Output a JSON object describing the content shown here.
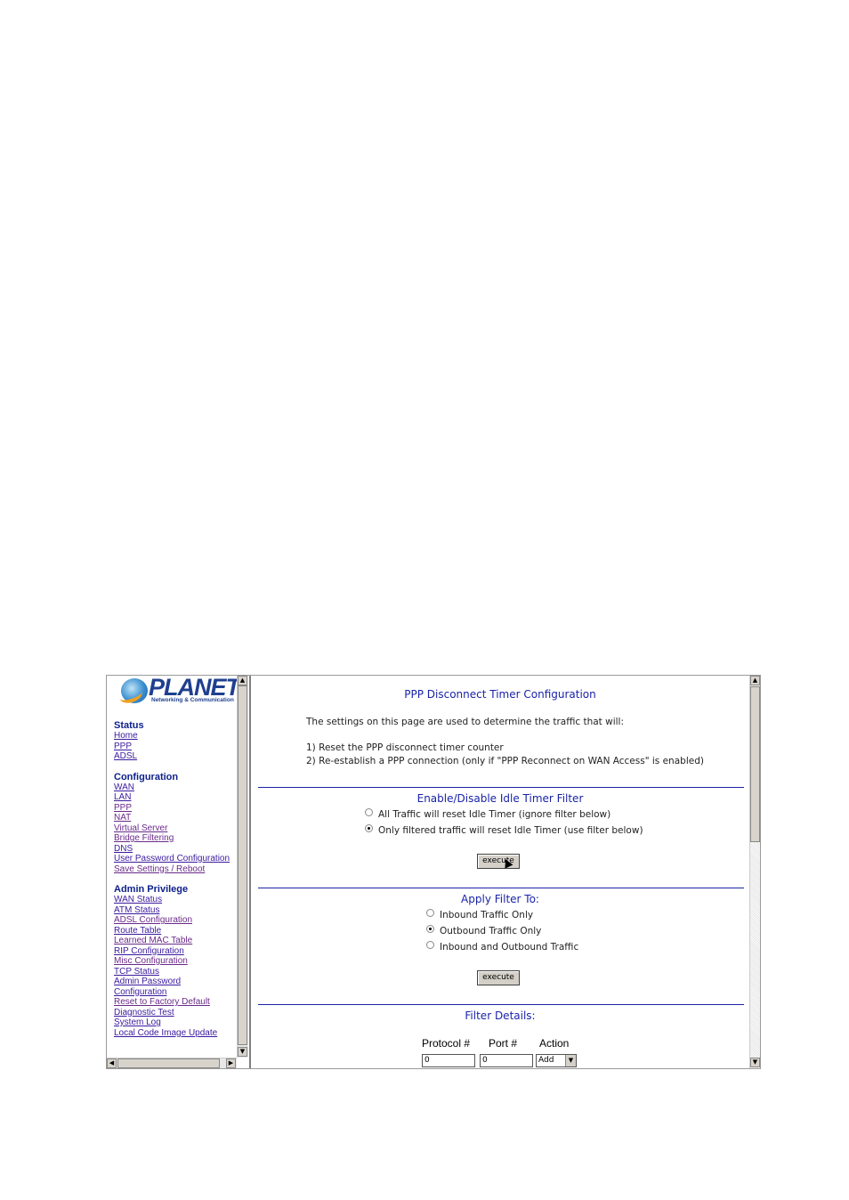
{
  "logo": {
    "brand": "PLANET",
    "tagline": "Networking & Communication"
  },
  "sidebar": {
    "status": {
      "heading": "Status",
      "items": [
        "Home",
        "PPP",
        "ADSL"
      ]
    },
    "configuration": {
      "heading": "Configuration",
      "items": [
        "WAN",
        "LAN",
        "PPP",
        "NAT",
        "Virtual Server",
        "Bridge Filtering",
        "DNS",
        "User Password Configuration",
        "Save Settings / Reboot"
      ]
    },
    "admin": {
      "heading": "Admin Privilege",
      "items": [
        "WAN Status",
        "ATM Status",
        "ADSL Configuration",
        "Route Table",
        "Learned MAC Table",
        "RIP Configuration",
        "Misc Configuration",
        "TCP Status",
        "Admin Password",
        "Configuration",
        "Reset to Factory Default",
        "Diagnostic Test",
        "System Log",
        "Local Code Image Update"
      ]
    }
  },
  "main": {
    "title": "PPP Disconnect Timer Configuration",
    "intro": "The settings on this page are used to determine the traffic that will:",
    "point1": "1) Reset the PPP disconnect timer counter",
    "point2": "2) Re-establish a PPP connection (only if \"PPP Reconnect on WAN Access\" is enabled)",
    "idle_section": {
      "heading": "Enable/Disable Idle Timer Filter",
      "options": [
        "All Traffic will reset Idle Timer (ignore filter below)",
        "Only filtered traffic will reset Idle Timer (use filter below)"
      ],
      "selected": 1,
      "button": "execute"
    },
    "apply_section": {
      "heading": "Apply Filter To:",
      "options": [
        "Inbound Traffic Only",
        "Outbound Traffic Only",
        "Inbound and Outbound Traffic"
      ],
      "selected": 1,
      "button": "execute"
    },
    "filter_section": {
      "heading": "Filter Details:",
      "col_protocol": "Protocol #",
      "col_port": "Port #",
      "col_action": "Action",
      "protocol_value": "0",
      "port_value": "0",
      "action_value": "Add"
    }
  }
}
